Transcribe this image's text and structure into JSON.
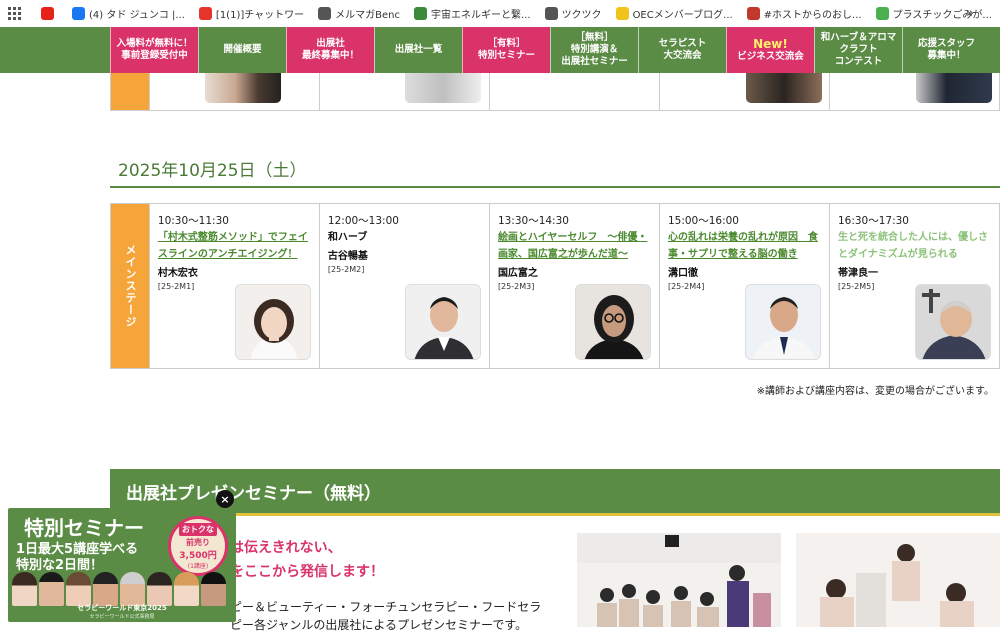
{
  "bookmarks": {
    "items": [
      {
        "label": "",
        "icon": "youtube-icon",
        "color": "#e62117"
      },
      {
        "label": "(4) タド ジュンコ |...",
        "icon": "facebook-icon",
        "color": "#1877f2"
      },
      {
        "label": "[1(1)]チャットワー",
        "icon": "chatwork-icon",
        "color": "#e4342b"
      },
      {
        "label": "メルマガBenc",
        "icon": "feather-icon",
        "color": "#555555"
      },
      {
        "label": "宇宙エネルギーと繋...",
        "icon": "shrine-icon",
        "color": "#3a8a3a"
      },
      {
        "label": "ツクツク",
        "icon": "folder-icon",
        "color": "#555555"
      },
      {
        "label": "OECメンバーブログ...",
        "icon": "j-icon",
        "color": "#f2c31a"
      },
      {
        "label": "#ホストからのおし...",
        "icon": "broadcast-icon",
        "color": "#c0392b"
      },
      {
        "label": "プラスチックごみが...",
        "icon": "leaf-icon",
        "color": "#4caf50"
      }
    ],
    "more": "»"
  },
  "nav": {
    "items": [
      {
        "line1": "入場料が無料に！",
        "line2": "事前登録受付中",
        "line3": "",
        "pink": true
      },
      {
        "line1": "開催概要",
        "line2": "",
        "line3": "",
        "pink": false
      },
      {
        "line1": "出展社",
        "line2": "最終募集中！",
        "line3": "",
        "pink": true
      },
      {
        "line1": "出展社一覧",
        "line2": "",
        "line3": "",
        "pink": false
      },
      {
        "line1": "［有料］",
        "line2": "特別セミナー",
        "line3": "",
        "pink": true
      },
      {
        "line1": "［無料］",
        "line2": "特別講演＆",
        "line3": "出展社セミナー",
        "pink": false
      },
      {
        "line1": "セラピスト",
        "line2": "大交流会",
        "line3": "",
        "pink": false
      },
      {
        "line1": "New!",
        "line2": "ビジネス交流会",
        "line3": "",
        "pink": true,
        "big": true
      },
      {
        "line1": "和ハーブ＆アロマ",
        "line2": "クラフト",
        "line3": "コンテスト",
        "pink": false
      },
      {
        "line1": "応援スタッフ",
        "line2": "募集中！",
        "line3": "",
        "pink": false
      }
    ]
  },
  "schedule": {
    "date": "2025年10月25日（土）",
    "stage": "メインステージ",
    "slots": [
      {
        "time": "10:30〜11:30",
        "title": "「村木式整筋メソッド」でフェイスラインのアンチエイジング！",
        "style": "link",
        "speaker": "村木宏衣",
        "code": "[25-2M1]"
      },
      {
        "time": "12:00〜13:00",
        "title": "和ハーブ",
        "style": "plain",
        "speaker": "古谷暢基",
        "code": "[25-2M2]"
      },
      {
        "time": "13:30〜14:30",
        "title": "絵画とハイヤーセルフ　〜俳優・画家、国広富之が歩んだ道〜",
        "style": "link",
        "speaker": "国広富之",
        "code": "[25-2M3]"
      },
      {
        "time": "15:00〜16:00",
        "title": "心の乱れは栄養の乱れが原因　食事・サプリで整える脳の働き",
        "style": "link",
        "speaker": "溝口徹",
        "code": "[25-2M4]"
      },
      {
        "time": "16:30〜17:30",
        "title": "生と死を統合した人には、優しさとダイナミズムが見られる",
        "style": "faded",
        "speaker": "帯津良一",
        "code": "[25-2M5]"
      }
    ],
    "notice": "※講師および講座内容は、変更の場合がございます。"
  },
  "seminar": {
    "heading": "出展社プレゼンセミナー（無料）",
    "pink1": "は伝えきれない、",
    "pink2": "をここから発信します！",
    "body1": "ピー＆ビューティー・フォーチュンセラピー・フードセラ",
    "body2": "ピー各ジャンルの出展社によるプレゼンセミナーです。"
  },
  "popup": {
    "title": "特別セミナー",
    "line1": "1日最大5講座学べる",
    "line2": "特別な2日間！",
    "badge1": "おトクな",
    "badge2": "前売り",
    "price": "3,500円",
    "unit": "(1講座)",
    "footer": "セラピーワールド東京2025",
    "footer_sub": "セラピーワールド公式事務局",
    "close": "×"
  },
  "colors": {
    "green": "#5b8c46",
    "pink": "#d9336a",
    "orange": "#f5a53a",
    "link_green": "#4b8a2f"
  }
}
